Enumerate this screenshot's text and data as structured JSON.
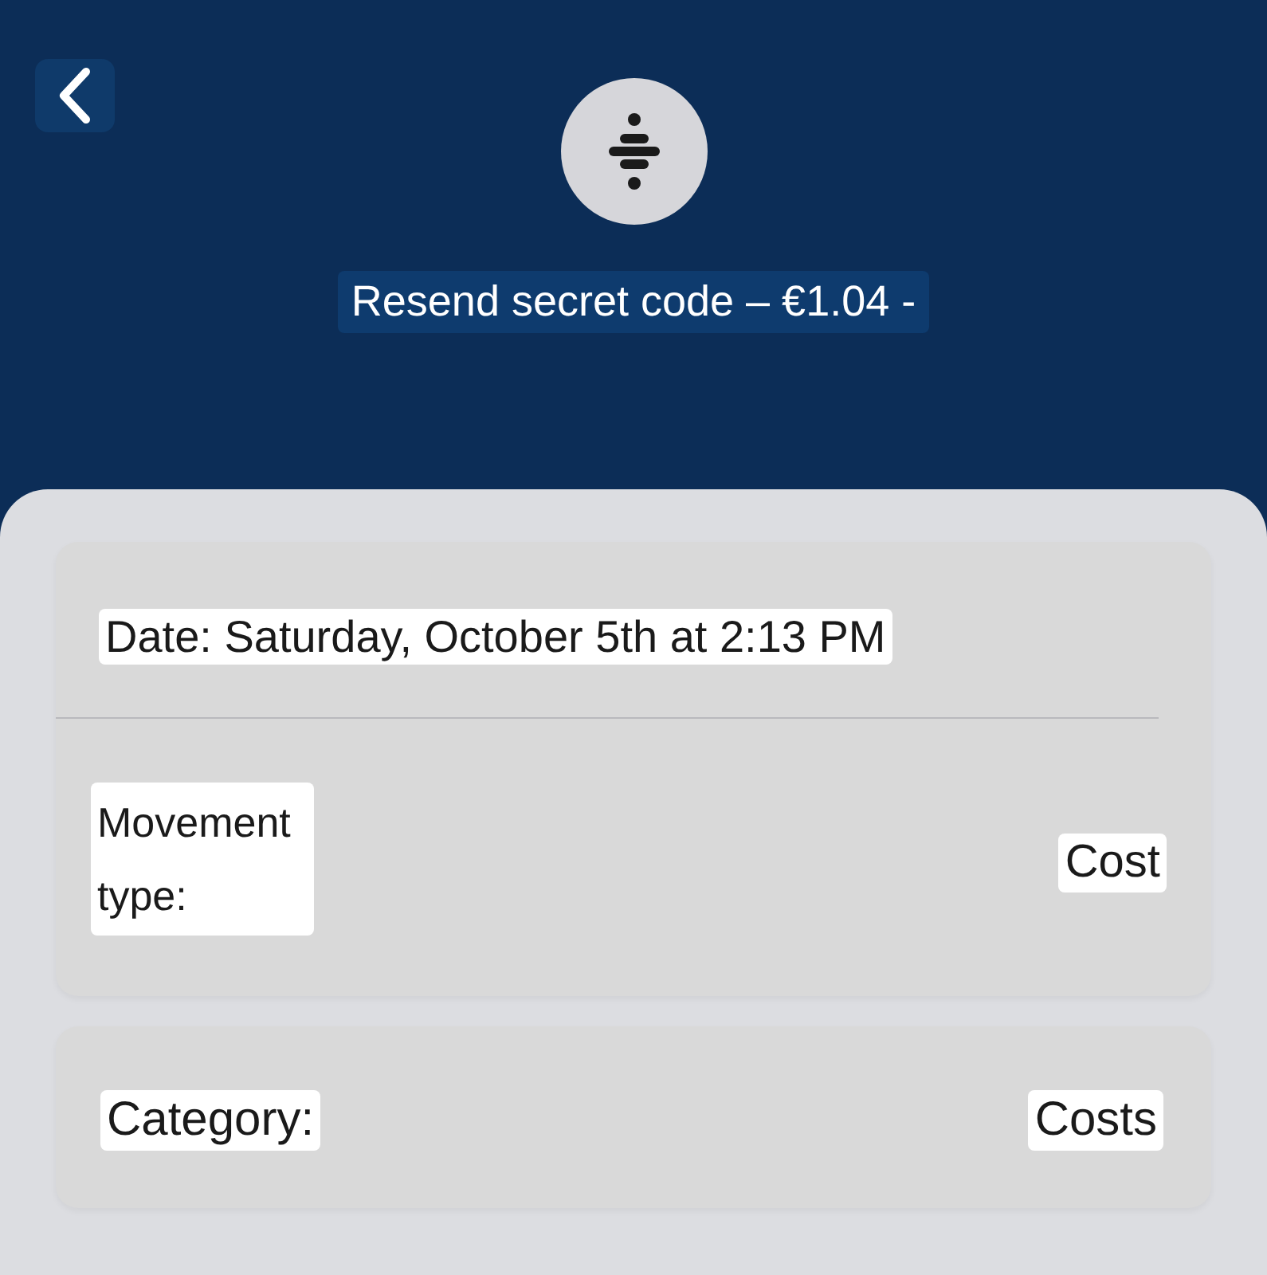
{
  "header": {
    "title": "Resend secret code – €1.04 -"
  },
  "details": [
    {
      "kind": "date",
      "label": "Date: Saturday, October 5th at 2:13 PM"
    },
    {
      "kind": "pair",
      "label": "Movement type:",
      "value": "Cost"
    }
  ],
  "category": {
    "label": "Category:",
    "value": "Costs"
  }
}
